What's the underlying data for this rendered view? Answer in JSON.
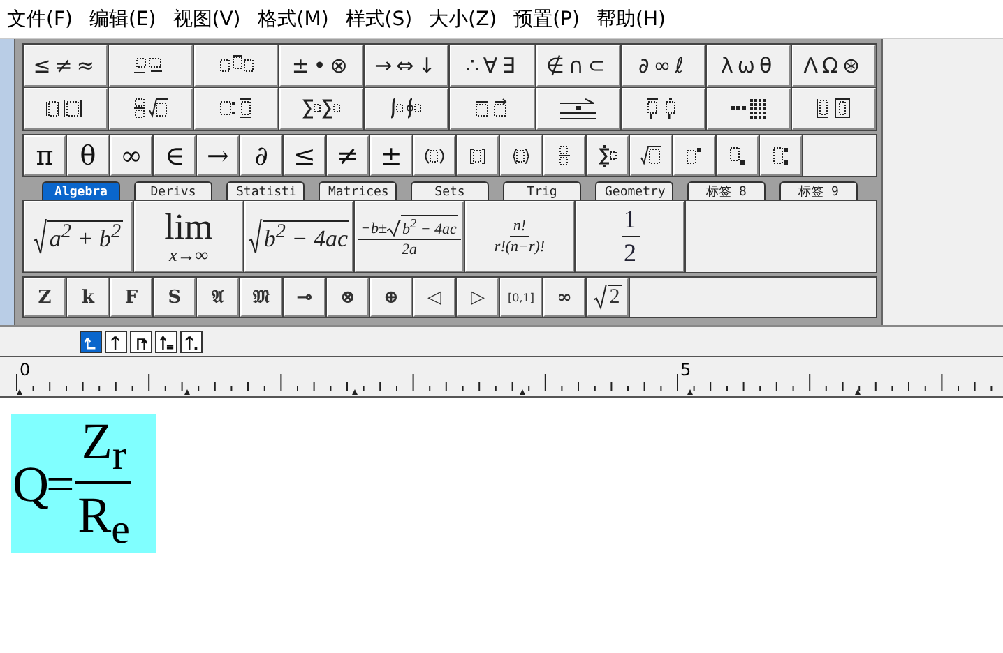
{
  "menu": [
    "文件(F)",
    "编辑(E)",
    "视图(V)",
    "格式(M)",
    "样式(S)",
    "大小(Z)",
    "预置(P)",
    "帮助(H)"
  ],
  "palette_rows": [
    [
      {
        "kind": "symbols",
        "label": "≤≠≈"
      },
      {
        "kind": "template"
      },
      {
        "kind": "template"
      },
      {
        "kind": "symbols",
        "label": "±•⊗"
      },
      {
        "kind": "symbols",
        "label": "→⇔↓"
      },
      {
        "kind": "symbols",
        "label": "∴∀∃"
      },
      {
        "kind": "symbols",
        "label": "∉∩⊂"
      },
      {
        "kind": "symbols",
        "label": "∂∞ℓ"
      },
      {
        "kind": "symbols",
        "label": "λωθ"
      },
      {
        "kind": "symbols",
        "label": "ΛΩ⊛"
      }
    ],
    [
      {
        "kind": "template"
      },
      {
        "kind": "template"
      },
      {
        "kind": "template"
      },
      {
        "kind": "template"
      },
      {
        "kind": "template"
      },
      {
        "kind": "template"
      },
      {
        "kind": "template"
      },
      {
        "kind": "template"
      },
      {
        "kind": "template"
      },
      {
        "kind": "template"
      }
    ]
  ],
  "symbol_bar": [
    {
      "kind": "symbol",
      "label": "π"
    },
    {
      "kind": "symbol",
      "label": "θ"
    },
    {
      "kind": "symbol",
      "label": "∞"
    },
    {
      "kind": "symbol",
      "label": "∈"
    },
    {
      "kind": "symbol",
      "label": "→"
    },
    {
      "kind": "symbol",
      "label": "∂"
    },
    {
      "kind": "symbol",
      "label": "≤"
    },
    {
      "kind": "symbol",
      "label": "≠"
    },
    {
      "kind": "symbol",
      "label": "±"
    },
    {
      "kind": "template"
    },
    {
      "kind": "template"
    },
    {
      "kind": "template"
    },
    {
      "kind": "template"
    },
    {
      "kind": "template"
    },
    {
      "kind": "template"
    },
    {
      "kind": "template"
    },
    {
      "kind": "template"
    },
    {
      "kind": "template"
    }
  ],
  "tabs": [
    {
      "label": "Algebra",
      "selected": true
    },
    {
      "label": "Derivs",
      "selected": false
    },
    {
      "label": "Statisti",
      "selected": false
    },
    {
      "label": "Matrices",
      "selected": false
    },
    {
      "label": "Sets",
      "selected": false
    },
    {
      "label": "Trig",
      "selected": false
    },
    {
      "label": "Geometry",
      "selected": false
    },
    {
      "label": "标签 8",
      "selected": false
    },
    {
      "label": "标签 9",
      "selected": false
    }
  ],
  "expressions": [
    {
      "kind": "root",
      "radicand": "a$^{2}$ + b$^{2}$"
    },
    {
      "kind": "limit",
      "top": "lim",
      "bottom": "x→∞"
    },
    {
      "kind": "root",
      "radicand": "b$^{2}$ − 4ac"
    },
    {
      "kind": "fraction",
      "numerator": "−b±",
      "numerator_radicand": "b$^{2}$ − 4ac",
      "denominator": "2a"
    },
    {
      "kind": "fraction",
      "numerator": "n!",
      "denominator": "r!(n−r)!"
    },
    {
      "kind": "fraction",
      "numerator": "1",
      "denominator": "2"
    }
  ],
  "bottom_bar": [
    {
      "kind": "symbol",
      "label": "Z"
    },
    {
      "kind": "symbol",
      "label": "k"
    },
    {
      "kind": "symbol",
      "label": "F"
    },
    {
      "kind": "symbol",
      "label": "S"
    },
    {
      "kind": "symbol",
      "label": "𝔄"
    },
    {
      "kind": "symbol",
      "label": "𝔐"
    },
    {
      "kind": "symbol",
      "label": "⊸"
    },
    {
      "kind": "symbol",
      "label": "⊗"
    },
    {
      "kind": "symbol",
      "label": "⊕"
    },
    {
      "kind": "symbol",
      "label": "◁"
    },
    {
      "kind": "symbol",
      "label": "▷"
    },
    {
      "kind": "small",
      "label": "[0,1]"
    },
    {
      "kind": "symbol",
      "label": "∞"
    },
    {
      "kind": "root",
      "radicand": "2"
    }
  ],
  "nudge_buttons": [
    {
      "selected": true
    },
    {
      "selected": false
    },
    {
      "selected": false
    },
    {
      "selected": false
    },
    {
      "selected": false
    }
  ],
  "ruler": {
    "labels": [
      "0",
      "5"
    ]
  },
  "equation": {
    "lhs": "Q=",
    "numerator": "Z$_{r}$",
    "denominator": "R$_{e}$",
    "selected": true
  }
}
